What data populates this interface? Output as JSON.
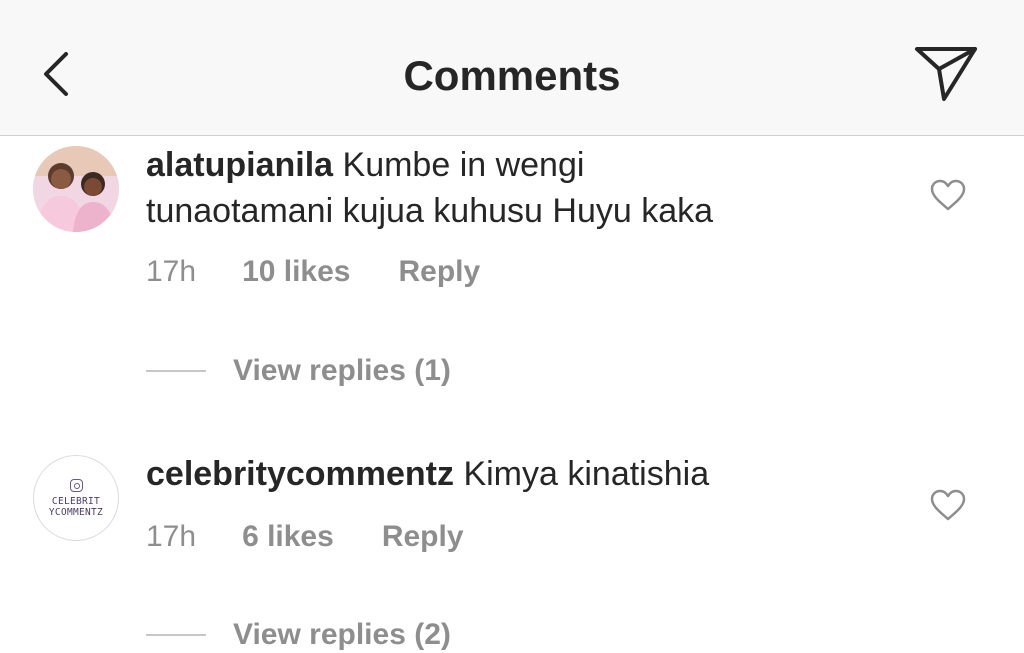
{
  "header": {
    "title": "Comments",
    "back_icon": "chevron-left-icon",
    "send_icon": "paper-plane-icon"
  },
  "comments": [
    {
      "username": "alatupianila",
      "text_line1": "Kumbe in wengi",
      "text_line2": "tunaotamani kujua kuhusu Huyu kaka",
      "time": "17h",
      "likes": "10 likes",
      "reply": "Reply",
      "view_replies": "View replies (1)"
    },
    {
      "username": "celebritycommentz",
      "text": "Kimya kinatishia",
      "avatar_text_line1": "CELEBRIT",
      "avatar_text_line2": "YCOMMENTZ",
      "time": "17h",
      "likes": "6 likes",
      "reply": "Reply",
      "view_replies": "View replies (2)"
    }
  ],
  "colors": {
    "header_bg": "#f8f8f8",
    "primary_text": "#262626",
    "secondary_text": "#8e8e8e",
    "divider": "#cfcfcf"
  }
}
